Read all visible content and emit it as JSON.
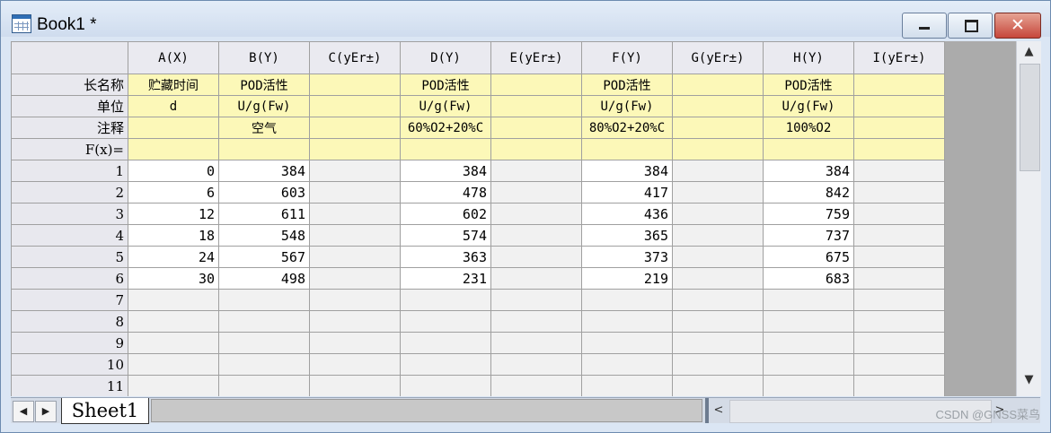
{
  "window": {
    "title": "Book1 *",
    "minimize_glyph": "",
    "maximize_glyph": "",
    "close_glyph": "✕"
  },
  "columns": [
    "A(X)",
    "B(Y)",
    "C(yEr±)",
    "D(Y)",
    "E(yEr±)",
    "F(Y)",
    "G(yEr±)",
    "H(Y)",
    "I(yEr±)"
  ],
  "row_labels": {
    "long_name": "长名称",
    "units": "单位",
    "comments": "注释",
    "formula": "F(x)="
  },
  "long_name": [
    "贮藏时间",
    "POD活性",
    "",
    "POD活性",
    "",
    "POD活性",
    "",
    "POD活性",
    ""
  ],
  "units": [
    "d",
    "U/g(Fw)",
    "",
    "U/g(Fw)",
    "",
    "U/g(Fw)",
    "",
    "U/g(Fw)",
    ""
  ],
  "comments": [
    "",
    "空气",
    "",
    "60%O2+20%C",
    "",
    "80%O2+20%C",
    "",
    "100%O2",
    ""
  ],
  "row_numbers": [
    "1",
    "2",
    "3",
    "4",
    "5",
    "6",
    "7",
    "8",
    "9",
    "10",
    "11"
  ],
  "data": [
    [
      "0",
      "384",
      "",
      "384",
      "",
      "384",
      "",
      "384",
      ""
    ],
    [
      "6",
      "603",
      "",
      "478",
      "",
      "417",
      "",
      "842",
      ""
    ],
    [
      "12",
      "611",
      "",
      "602",
      "",
      "436",
      "",
      "759",
      ""
    ],
    [
      "18",
      "548",
      "",
      "574",
      "",
      "365",
      "",
      "737",
      ""
    ],
    [
      "24",
      "567",
      "",
      "363",
      "",
      "373",
      "",
      "675",
      ""
    ],
    [
      "30",
      "498",
      "",
      "231",
      "",
      "219",
      "",
      "683",
      ""
    ]
  ],
  "sheet_tab": "Sheet1",
  "scroll": {
    "up": "▲",
    "down": "▼",
    "left": "<",
    "right": ">",
    "nav_left": "◀",
    "nav_right": "▶"
  },
  "watermark": "CSDN @GNSS菜鸟"
}
